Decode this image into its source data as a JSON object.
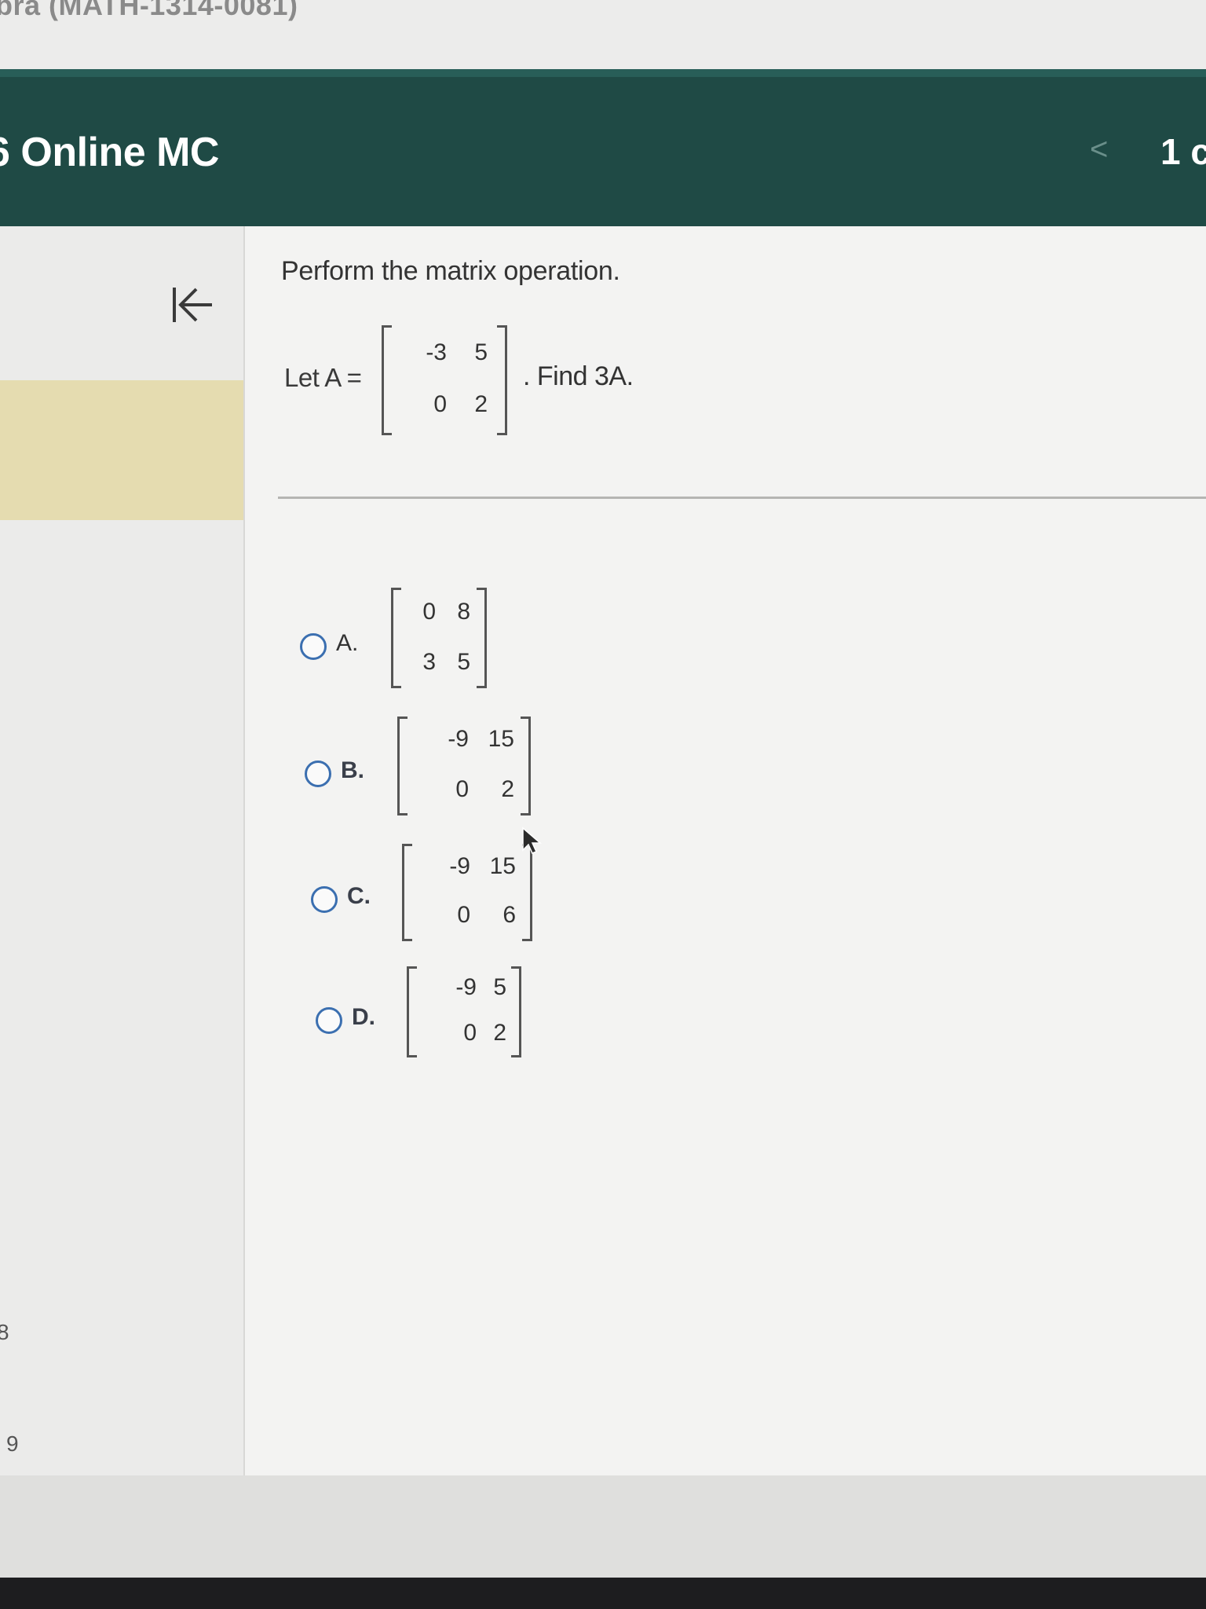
{
  "browser": {
    "course_title": "bra (MATH-1314-0081)"
  },
  "header": {
    "assignment_title": "6 Online MC",
    "prev_icon": "chevron-left-icon",
    "prev_glyph": "<",
    "question_counter": "1 c"
  },
  "sidebar": {
    "collapse_icon": "collapse-left-arrow-icon",
    "collapse_glyph": "⇤",
    "visible_numbers": [
      "8",
      "9"
    ]
  },
  "question": {
    "prompt": "Perform the matrix operation.",
    "let_label": "Let A =",
    "find_label": ". Find 3A.",
    "matrix_A": [
      [
        "-3",
        "5"
      ],
      [
        "0",
        "2"
      ]
    ]
  },
  "options": [
    {
      "letter": "A.",
      "matrix": [
        [
          "0",
          "8"
        ],
        [
          "3",
          "5"
        ]
      ]
    },
    {
      "letter": "B.",
      "matrix": [
        [
          "-9",
          "15"
        ],
        [
          "0",
          "2"
        ]
      ]
    },
    {
      "letter": "C.",
      "matrix": [
        [
          "-9",
          "15"
        ],
        [
          "0",
          "6"
        ]
      ]
    },
    {
      "letter": "D.",
      "matrix": [
        [
          "-9",
          "5"
        ],
        [
          "0",
          "2"
        ]
      ]
    }
  ],
  "colors": {
    "header": "#1f4a45",
    "radio_border": "#3b6fb0",
    "highlight": "#e5dcb0"
  }
}
